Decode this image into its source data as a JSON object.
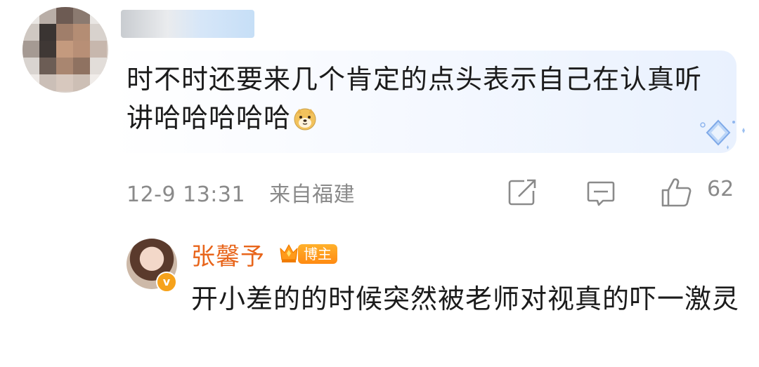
{
  "comment": {
    "username": "",
    "text": "时不时还要来几个肯定的点头表示自己在认真听讲哈哈哈哈哈",
    "timestamp": "12-9 13:31",
    "location": "来自福建",
    "like_count": "62",
    "emoji": "doge-emoji"
  },
  "reply": {
    "username": "张馨予",
    "badge_label": "博主",
    "verify_glyph": "v",
    "text": "开小差的的时候突然被老师对视真的吓一激灵"
  },
  "colors": {
    "reply_name": "#e8651b",
    "meta_gray": "#8a8a8a",
    "badge_orange": "#ff8a12",
    "bubble_blue": "#e9f1fe"
  }
}
